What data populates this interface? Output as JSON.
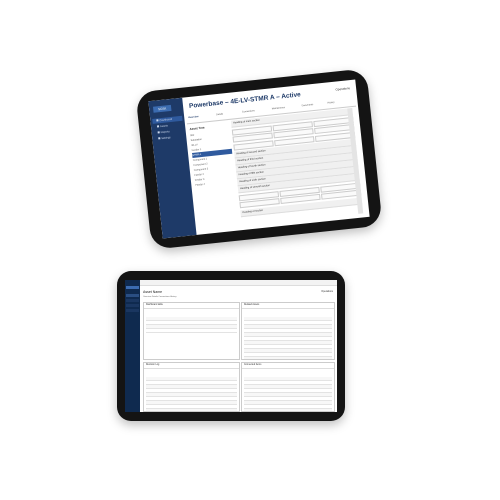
{
  "tablet_top": {
    "logo": "SCSK",
    "title": "Powerbase – 4E-LV-STMR A – Active",
    "header_right": "Operations",
    "nav": [
      {
        "label": "Dashboard"
      },
      {
        "label": "Assets"
      },
      {
        "label": "Reports"
      },
      {
        "label": "Settings"
      }
    ],
    "tabs": [
      "Overview",
      "Details",
      "Connections",
      "Maintenance",
      "Documents",
      "History"
    ],
    "tree_header": "Asset Tree",
    "tree": [
      "Site",
      "Substation",
      "4E-LV",
      "Feeder 1",
      "STMR A",
      "Component 1",
      "Component 2",
      "Component 3",
      "Feeder 2",
      "Feeder 3",
      "Feeder 4"
    ],
    "sections": [
      "Heading of main section",
      "Heading of second section",
      "Heading of third section",
      "Heading of fourth section",
      "Heading of fifth section",
      "Heading of sixth section",
      "Heading of seventh section",
      "Heading of section"
    ]
  },
  "tablet_bottom": {
    "title": "Asset Name",
    "header_right": "Operations",
    "tabs": "Overview   Details   Connections   History",
    "cards": [
      "Dashboard table",
      "Related Assets",
      "Revision Log",
      "Connected Items"
    ]
  }
}
